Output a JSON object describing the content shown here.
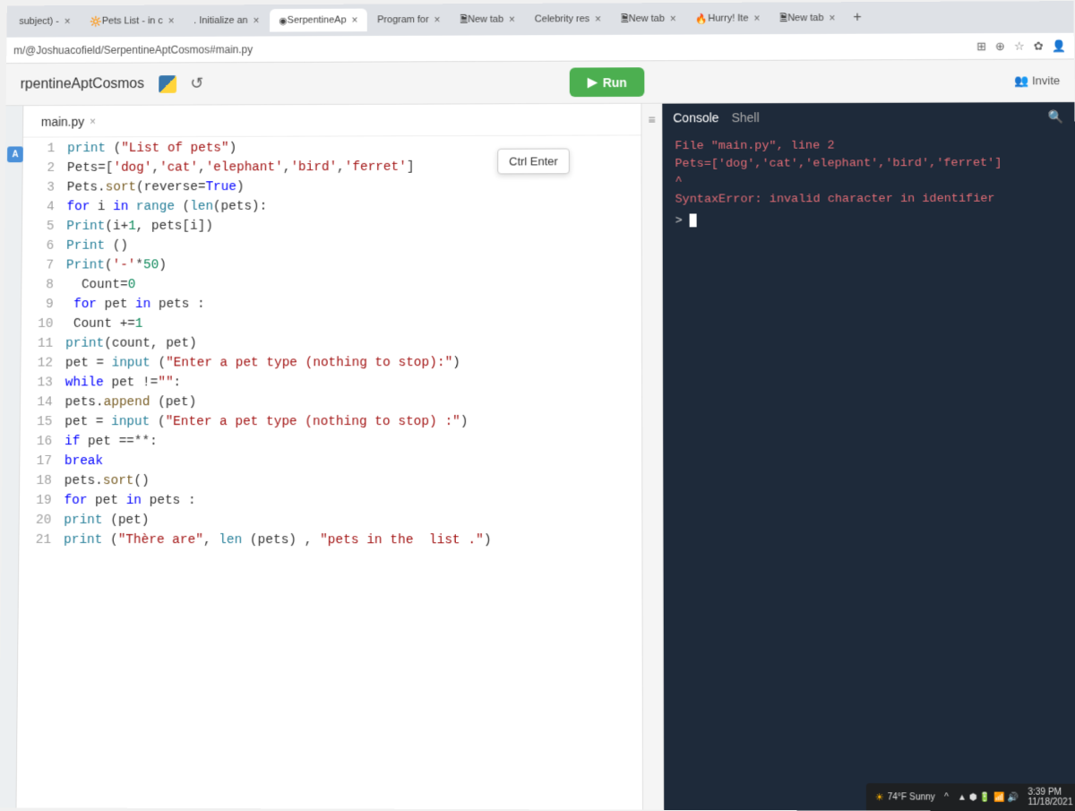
{
  "browser": {
    "tabs": [
      {
        "label": "subject) -",
        "active": false
      },
      {
        "label": "Pets List - in c",
        "active": false
      },
      {
        "label": ". Initialize an",
        "active": false
      },
      {
        "label": "SerpentineAp",
        "active": true
      },
      {
        "label": "Program for",
        "active": false
      },
      {
        "label": "New tab",
        "active": false
      },
      {
        "label": "Celebrity res",
        "active": false
      },
      {
        "label": "New tab",
        "active": false
      },
      {
        "label": "Hurry! Ite",
        "active": false
      },
      {
        "label": "New tab",
        "active": false
      }
    ],
    "url": "m/@Joshuacofield/SerpentineAptCosmos#main.py"
  },
  "replit": {
    "title": "rpentineAptCosmos",
    "run_label": "Run",
    "shortcut": "Ctrl Enter",
    "invite_label": "Invite",
    "file_tab": "main.py",
    "ai_badge": "A"
  },
  "code": {
    "lines": [
      {
        "n": 1,
        "html": "<span class='k-func'>print</span> (<span class='k-str'>\"List of pets\"</span>)"
      },
      {
        "n": 2,
        "html": "Pets=[<span class='k-str'>'dog'</span>,<span class='k-str'>'cat'</span>,<span class='k-str'>'elephant'</span>,<span class='k-str'>'bird'</span>,<span class='k-str'>'ferret'</span>]"
      },
      {
        "n": 3,
        "html": "Pets.<span class='k-method'>sort</span>(reverse=<span class='k-bool'>True</span>)"
      },
      {
        "n": 4,
        "html": "<span class='k-kw'>for</span> i <span class='k-kw'>in</span> <span class='k-builtin'>range</span> (<span class='k-builtin'>len</span>(pets):"
      },
      {
        "n": 5,
        "html": "<span class='k-func'>Print</span>(i+<span class='k-num'>1</span>, pets[i])"
      },
      {
        "n": 6,
        "html": "<span class='k-func'>Print</span> ()"
      },
      {
        "n": 7,
        "html": "<span class='k-func'>Print</span>(<span class='k-str'>'-'</span>*<span class='k-num'>50</span>)"
      },
      {
        "n": 8,
        "html": "  Count=<span class='k-num'>0</span>"
      },
      {
        "n": 9,
        "html": " <span class='k-kw'>for</span> pet <span class='k-kw'>in</span> pets :"
      },
      {
        "n": 10,
        "html": " Count +=<span class='k-num'>1</span>"
      },
      {
        "n": 11,
        "html": "<span class='k-func'>print</span>(count, pet)"
      },
      {
        "n": 12,
        "html": "pet = <span class='k-builtin'>input</span> (<span class='k-str'>\"Enter a pet type (nothing to stop):\"</span>)"
      },
      {
        "n": 13,
        "html": "<span class='k-kw'>while</span> pet !=<span class='k-str'>\"\"</span>:"
      },
      {
        "n": 14,
        "html": "pets.<span class='k-method'>append</span> (pet)"
      },
      {
        "n": 15,
        "html": "pet = <span class='k-builtin'>input</span> (<span class='k-str'>\"Enter a pet type (nothing to stop) :\"</span>)"
      },
      {
        "n": 16,
        "html": "<span class='k-kw'>if</span> pet ==**:"
      },
      {
        "n": 17,
        "html": "<span class='k-kw'>break</span>"
      },
      {
        "n": 18,
        "html": "pets.<span class='k-method'>sort</span>()"
      },
      {
        "n": 19,
        "html": "<span class='k-kw'>for</span> pet <span class='k-kw'>in</span> pets :"
      },
      {
        "n": 20,
        "html": "<span class='k-func'>print</span> (pet)"
      },
      {
        "n": 21,
        "html": "<span class='k-func'>print</span> (<span class='k-str'>\"Thère are\"</span>, <span class='k-builtin'>len</span> (pets) , <span class='k-str'>\"pets in the  list .\"</span>)"
      }
    ]
  },
  "console": {
    "tab_console": "Console",
    "tab_shell": "Shell",
    "err_line1": "File \"main.py\", line 2",
    "err_line2": "  Pets=['dog','cat','elephant','bird','ferret']",
    "err_caret": "          ^",
    "err_msg": "SyntaxError: invalid character in identifier",
    "prompt": ">"
  },
  "taskbar": {
    "weather": "74°F Sunny",
    "time": "3:39 PM",
    "date": "11/18/2021"
  }
}
